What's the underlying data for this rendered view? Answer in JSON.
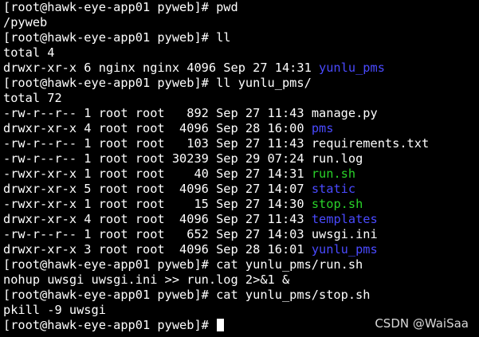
{
  "terminal": {
    "lines": [
      {
        "text": "[root@hawk-eye-app01 pyweb]# pwd"
      },
      {
        "text": "/pyweb"
      },
      {
        "text": "[root@hawk-eye-app01 pyweb]# ll"
      },
      {
        "text": "total 4"
      },
      {
        "text": "drwxr-xr-x 6 nginx nginx 4096 Sep 27 14:31 ",
        "name": "yunlu_pms",
        "kind": "dir"
      },
      {
        "text": "[root@hawk-eye-app01 pyweb]# ll yunlu_pms/"
      },
      {
        "text": "total 72"
      },
      {
        "text": "-rw-r--r-- 1 root root   892 Sep 27 11:43 ",
        "name": "manage.py",
        "kind": "file"
      },
      {
        "text": "drwxr-xr-x 4 root root  4096 Sep 28 16:00 ",
        "name": "pms",
        "kind": "dir"
      },
      {
        "text": "-rw-r--r-- 1 root root   103 Sep 27 11:43 ",
        "name": "requirements.txt",
        "kind": "file"
      },
      {
        "text": "-rw-r--r-- 1 root root 30239 Sep 29 07:24 ",
        "name": "run.log",
        "kind": "file"
      },
      {
        "text": "-rwxr-xr-x 1 root root    40 Sep 27 14:31 ",
        "name": "run.sh",
        "kind": "exec"
      },
      {
        "text": "drwxr-xr-x 5 root root  4096 Sep 27 14:07 ",
        "name": "static",
        "kind": "dir"
      },
      {
        "text": "-rwxr-xr-x 1 root root    15 Sep 27 14:30 ",
        "name": "stop.sh",
        "kind": "exec"
      },
      {
        "text": "drwxr-xr-x 4 root root  4096 Sep 27 11:43 ",
        "name": "templates",
        "kind": "dir"
      },
      {
        "text": "-rw-r--r-- 1 root root   652 Sep 27 14:03 ",
        "name": "uwsgi.ini",
        "kind": "file"
      },
      {
        "text": "drwxr-xr-x 3 root root  4096 Sep 28 16:01 ",
        "name": "yunlu_pms",
        "kind": "dir"
      },
      {
        "text": "[root@hawk-eye-app01 pyweb]# cat yunlu_pms/run.sh"
      },
      {
        "text": "nohup uwsgi uwsgi.ini >> run.log 2>&1 &"
      },
      {
        "text": "[root@hawk-eye-app01 pyweb]# cat yunlu_pms/stop.sh"
      },
      {
        "text": "pkill -9 uwsgi"
      },
      {
        "text": "[root@hawk-eye-app01 pyweb]# ",
        "cursor": true
      }
    ]
  },
  "watermark": "CSDN @WaiSaa",
  "colors": {
    "background": "#000000",
    "text": "#ffffff",
    "directory": "#4a4aff",
    "executable": "#29d229"
  }
}
